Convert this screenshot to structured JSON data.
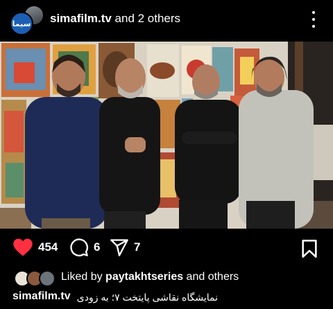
{
  "header": {
    "account": "simafilm.tv",
    "others": " and 2 others",
    "avatar_label": "سیما"
  },
  "post": {
    "likes": "454",
    "comments": "6",
    "shares": "7"
  },
  "liked_by": {
    "prefix": "Liked by ",
    "user": "paytakhtseries",
    "suffix": " and others"
  },
  "caption": {
    "user": "simafilm.tv",
    "text": "نمایشگاه نقاشی پایتخت ۷؛ به زودی"
  },
  "colors": {
    "background": "#000000",
    "heart": "#ff3040",
    "text": "#ffffff"
  }
}
